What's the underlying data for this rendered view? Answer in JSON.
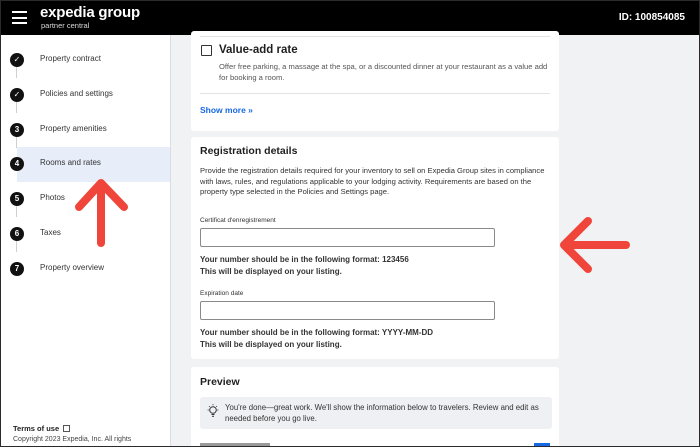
{
  "header": {
    "brand": "expedia group",
    "brand_sub": "partner central",
    "account_id": "ID: 100854085"
  },
  "sidebar": {
    "items": [
      {
        "badge": "✓",
        "label": "Property contract",
        "state": "done"
      },
      {
        "badge": "✓",
        "label": "Policies and settings",
        "state": "done"
      },
      {
        "badge": "3",
        "label": "Property amenities",
        "state": "todo"
      },
      {
        "badge": "4",
        "label": "Rooms and rates",
        "state": "active"
      },
      {
        "badge": "5",
        "label": "Photos",
        "state": "todo"
      },
      {
        "badge": "6",
        "label": "Taxes",
        "state": "todo"
      },
      {
        "badge": "7",
        "label": "Property overview",
        "state": "todo"
      }
    ],
    "footer": {
      "terms": "Terms of use",
      "copyright": "Copyright 2023 Expedia, Inc. All rights"
    }
  },
  "value_add": {
    "title": "Value-add rate",
    "description": "Offer free parking, a massage at the spa, or a discounted dinner at your restaurant as a value add for booking a room.",
    "show_more": "Show more »"
  },
  "registration": {
    "title": "Registration details",
    "description": "Provide the registration details required for your inventory to sell on Expedia Group sites in compliance with laws, rules, and regulations applicable to your lodging activity. Requirements are based on the property type selected in the Policies and Settings page.",
    "field1": {
      "label": "Certificat d'enregistrement",
      "value": "",
      "hint_line1": "Your number should be in the following format: 123456",
      "hint_line2": "This will be displayed on your listing."
    },
    "field2": {
      "label": "Expiration date",
      "value": "",
      "hint_line1": "Your number should be in the following format: YYYY-MM-DD",
      "hint_line2": "This will be displayed on your listing."
    }
  },
  "preview": {
    "title": "Preview",
    "message": "You're done—great work. We'll show the information below to travelers. Review and edit as needed before you go live."
  },
  "colors": {
    "accent_blue": "#1668e3",
    "annotation_red": "#f0453a",
    "topbar": "#000000",
    "active_nav_bg": "#e7eef9"
  }
}
